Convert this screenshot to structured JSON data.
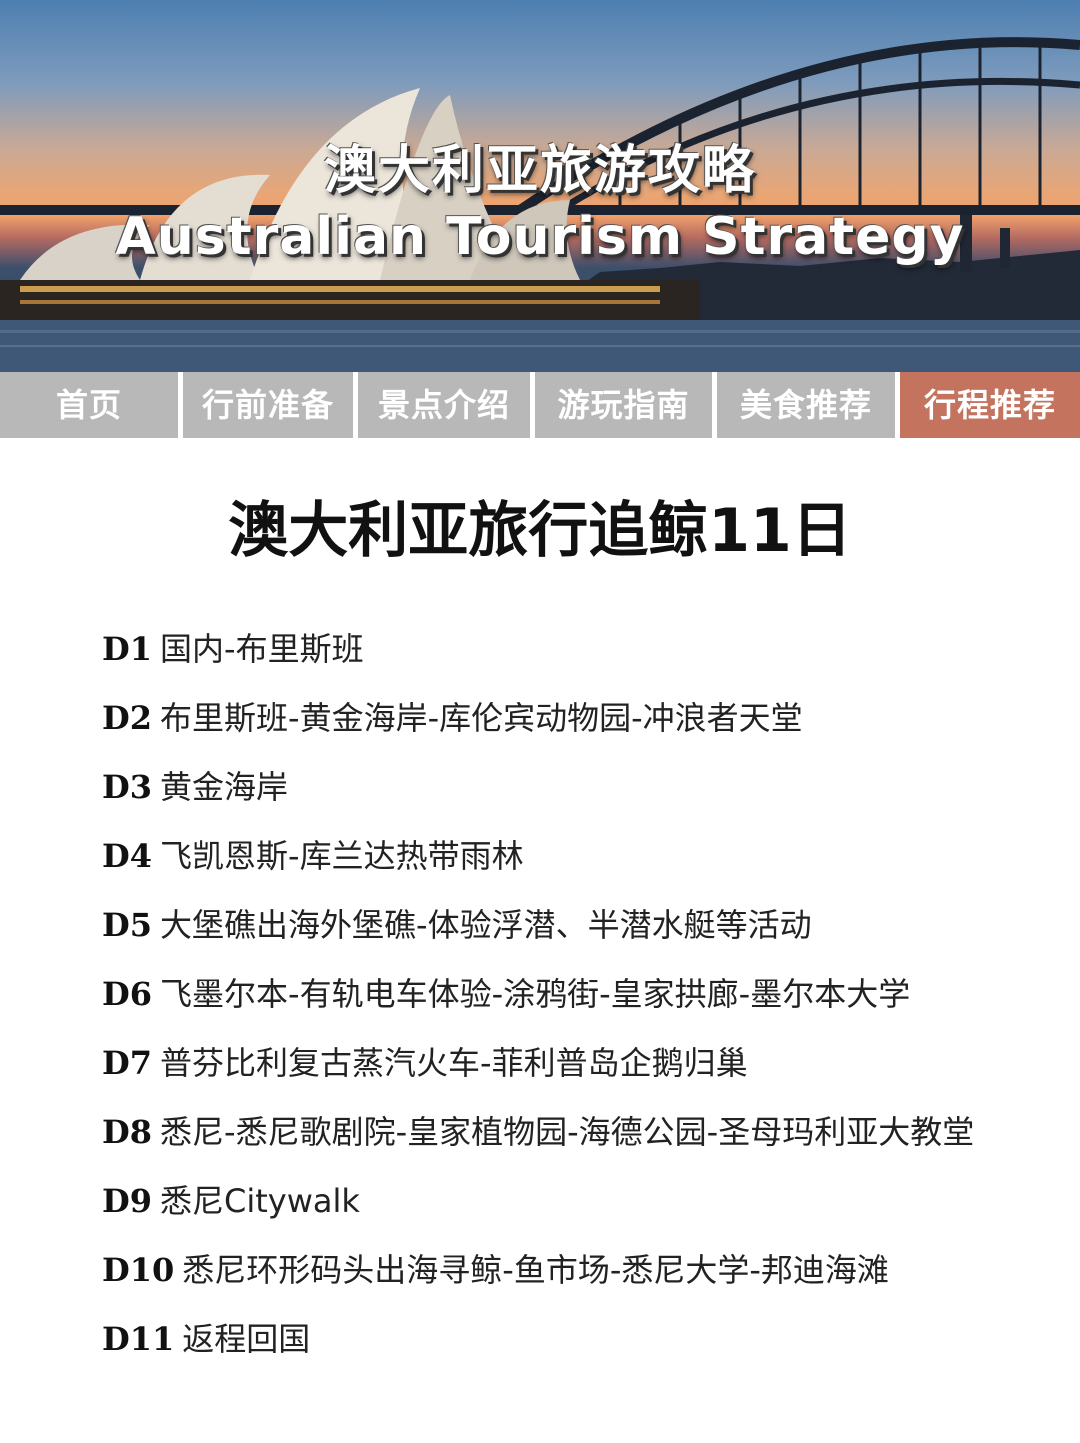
{
  "header": {
    "title_cn": "澳大利亚旅游攻略",
    "title_en": "Australian Tourism Strategy"
  },
  "nav": {
    "tabs": [
      {
        "label": "首页",
        "active": false
      },
      {
        "label": "行前准备",
        "active": false
      },
      {
        "label": "景点介绍",
        "active": false
      },
      {
        "label": "游玩指南",
        "active": false
      },
      {
        "label": "美食推荐",
        "active": false
      },
      {
        "label": "行程推荐",
        "active": true
      }
    ]
  },
  "main": {
    "title": "澳大利亚旅行追鲸11日",
    "itinerary": [
      {
        "day": "D1",
        "text": "国内-布里斯班"
      },
      {
        "day": "D2",
        "text": "布里斯班-黄金海岸-库伦宾动物园-冲浪者天堂"
      },
      {
        "day": "D3",
        "text": "黄金海岸"
      },
      {
        "day": "D4",
        "text": "飞凯恩斯-库兰达热带雨林"
      },
      {
        "day": "D5",
        "text": "大堡礁出海外堡礁-体验浮潜、半潜水艇等活动"
      },
      {
        "day": "D6",
        "text": "飞墨尔本-有轨电车体验-涂鸦街-皇家拱廊-墨尔本大学"
      },
      {
        "day": "D7",
        "text": "普芬比利复古蒸汽火车-菲利普岛企鹅归巢"
      },
      {
        "day": "D8",
        "text": "悉尼-悉尼歌剧院-皇家植物园-海德公园-圣母玛利亚大教堂"
      },
      {
        "day": "D9",
        "text": "悉尼Citywalk"
      },
      {
        "day": "D10",
        "text": "悉尼环形码头出海寻鲸-鱼市场-悉尼大学-邦迪海滩"
      },
      {
        "day": "D11",
        "text": "返程回国"
      }
    ]
  },
  "colors": {
    "nav_inactive": "#b8b8b8",
    "nav_active": "#c4735f"
  }
}
